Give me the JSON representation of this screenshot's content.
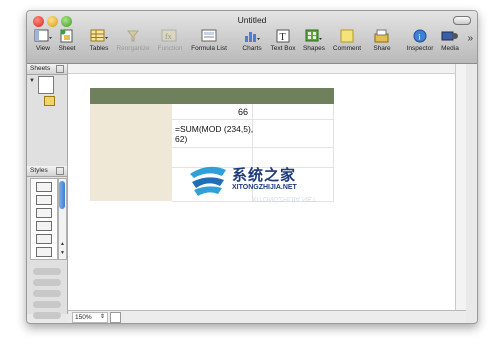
{
  "window": {
    "title": "Untitled"
  },
  "toolbar": {
    "items": [
      {
        "label": "View",
        "icon": "view-icon"
      },
      {
        "label": "Sheet",
        "icon": "sheet-icon"
      },
      {
        "label": "Tables",
        "icon": "tables-icon"
      },
      {
        "label": "Reorganize",
        "icon": "reorganize-icon",
        "disabled": true
      },
      {
        "label": "Function",
        "icon": "function-icon",
        "disabled": true
      },
      {
        "label": "Formula List",
        "icon": "formula-list-icon"
      },
      {
        "label": "Charts",
        "icon": "charts-icon"
      },
      {
        "label": "Text Box",
        "icon": "text-box-icon"
      },
      {
        "label": "Shapes",
        "icon": "shapes-icon"
      },
      {
        "label": "Comment",
        "icon": "comment-icon"
      },
      {
        "label": "Share",
        "icon": "share-icon"
      },
      {
        "label": "Inspector",
        "icon": "inspector-icon"
      },
      {
        "label": "Media",
        "icon": "media-icon"
      }
    ],
    "overflow": "»"
  },
  "sidebar": {
    "sheets_label": "Sheets",
    "styles_label": "Styles"
  },
  "table": {
    "value_cell": "66",
    "formula_text": "=SUM(MOD (234,5), 62)"
  },
  "watermark": {
    "line1": "系统之家",
    "line2": "XITONGZHIJIA.NET"
  },
  "status": {
    "zoom": "150%"
  },
  "colors": {
    "table_header": "#6f805c",
    "header_column": "#efe8d6",
    "accent_blue": "#3d7ed4"
  }
}
